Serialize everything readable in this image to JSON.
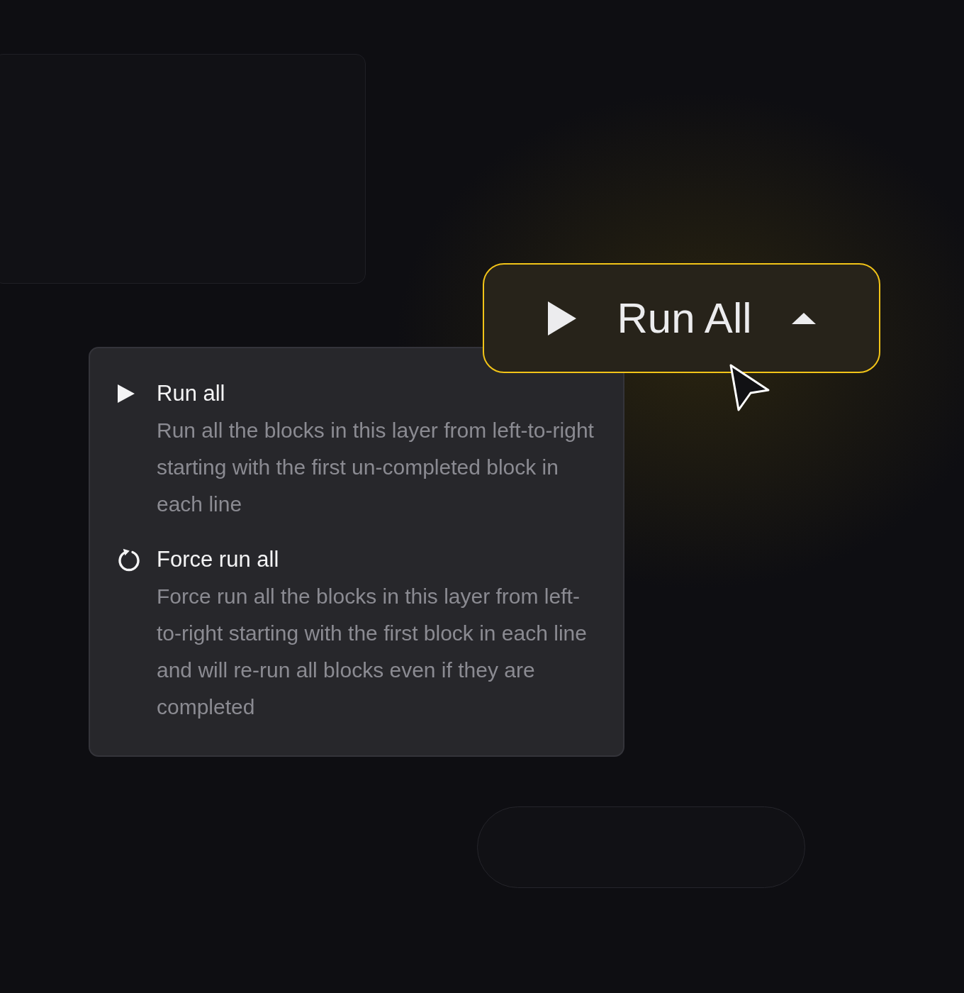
{
  "run_button": {
    "label": "Run All",
    "expanded": true
  },
  "menu": {
    "items": [
      {
        "kind": "run",
        "title": "Run all",
        "description": "Run all the blocks in this layer from left-to-right starting with the first un-completed block in each line"
      },
      {
        "kind": "force_run",
        "title": "Force run all",
        "description": "Force run all the blocks in this layer from left-to-right starting with the first block in each line and will re-run all blocks even if they are completed"
      }
    ]
  }
}
